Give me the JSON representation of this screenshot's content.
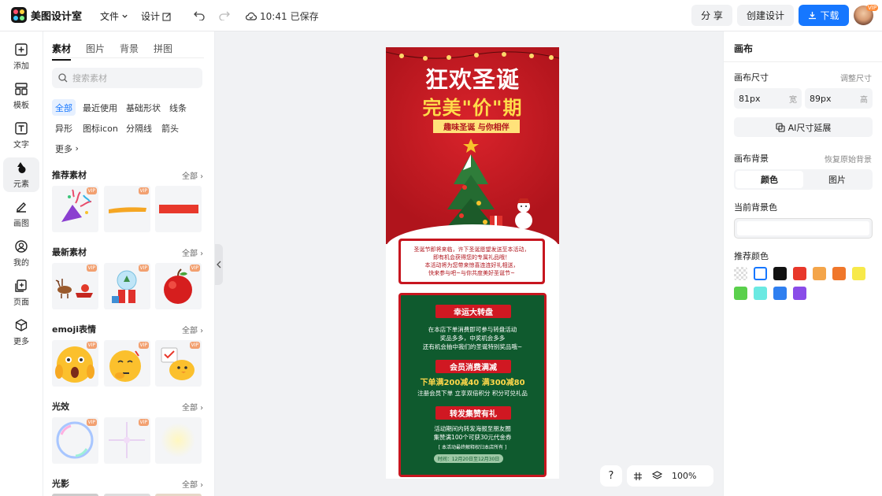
{
  "app": {
    "name": "美图设计室"
  },
  "topbar": {
    "file_menu": "文件",
    "design_menu": "设计",
    "save_time": "10:41",
    "save_text": "已保存",
    "share": "分 享",
    "create": "创建设计",
    "download": "下载",
    "avatar_badge": "VIP"
  },
  "rail": {
    "items": [
      {
        "label": "添加",
        "icon": "plus-square-icon"
      },
      {
        "label": "模板",
        "icon": "template-icon"
      },
      {
        "label": "文字",
        "icon": "text-icon"
      },
      {
        "label": "元素",
        "icon": "shapes-icon"
      },
      {
        "label": "画图",
        "icon": "draw-icon"
      },
      {
        "label": "我的",
        "icon": "user-icon"
      },
      {
        "label": "页面",
        "icon": "page-icon"
      },
      {
        "label": "更多",
        "icon": "cube-icon"
      }
    ]
  },
  "panel": {
    "tabs": [
      "素材",
      "图片",
      "背景",
      "拼图"
    ],
    "search_placeholder": "搜索素材",
    "chips": [
      "全部",
      "最近使用",
      "基础形状",
      "线条",
      "异形",
      "图标icon",
      "分隔线",
      "箭头",
      "更多"
    ],
    "all_label": "全部",
    "vip": "VIP",
    "sections": [
      {
        "title": "推荐素材",
        "thumbs": [
          "confetti-popper",
          "yellow-stroke",
          "red-bar"
        ]
      },
      {
        "title": "最新素材",
        "thumbs": [
          "reindeer-sleigh",
          "snow-globe-gift",
          "red-apple"
        ]
      },
      {
        "title": "emoji表情",
        "thumbs": [
          "shocked-emoji",
          "thinking-emoji",
          "chick-emoji"
        ]
      },
      {
        "title": "光效",
        "thumbs": [
          "bubble",
          "sparkle",
          "glow"
        ]
      },
      {
        "title": "光影",
        "thumbs": []
      }
    ]
  },
  "poster": {
    "title1": "狂欢圣诞",
    "title2": "完美\"价\"期",
    "ribbon": "趣味圣诞 与你相伴",
    "box1_lines": [
      "圣诞节即将来临，许下圣诞愿望发送至本活动，",
      "即有机会获得您的专属礼品哦！",
      "本活动将为您带来惊喜连连好礼相送，",
      "快来参与吧~与你共度美好圣诞节~"
    ],
    "sections": [
      {
        "ribbon": "幸运大转盘",
        "lines": [
          "在本店下单消费即可参与转盘活动",
          "奖品多多，中奖机会多多",
          "还有机会抽中我们的圣诞特别奖品哦~"
        ]
      },
      {
        "ribbon": "会员消费满减",
        "highlight": "下单满200减40 满300减80",
        "lines": [
          "注册会员下单 立享双倍积分 积分可兑礼品"
        ]
      },
      {
        "ribbon": "转发集赞有礼",
        "lines": [
          "活动期间内转发海报至朋友圈",
          "集赞满100个可获30元代金券"
        ]
      }
    ],
    "note": "[ 本活动最终解释权归本店所有 ]",
    "date_pill": "时间：12月20日至12月30日"
  },
  "zoom": {
    "help": "?",
    "level": "100%"
  },
  "right": {
    "title": "画布",
    "size_label": "画布尺寸",
    "adjust_link": "调整尺寸",
    "width_value": "81px",
    "width_unit": "宽",
    "height_value": "89px",
    "height_unit": "高",
    "ai_button": "AI尺寸延展",
    "bg_label": "画布背景",
    "restore_link": "恢复原始背景",
    "seg": [
      "颜色",
      "图片"
    ],
    "current_label": "当前背景色",
    "recommend_label": "推荐颜色",
    "swatches": [
      "transparent",
      "#ffffff",
      "#111111",
      "#e8382b",
      "#f4a54a",
      "#f0772b",
      "#f7e94a",
      "#5ad04c",
      "#6ae9e2",
      "#2f7ff0",
      "#8a4ce8"
    ]
  }
}
